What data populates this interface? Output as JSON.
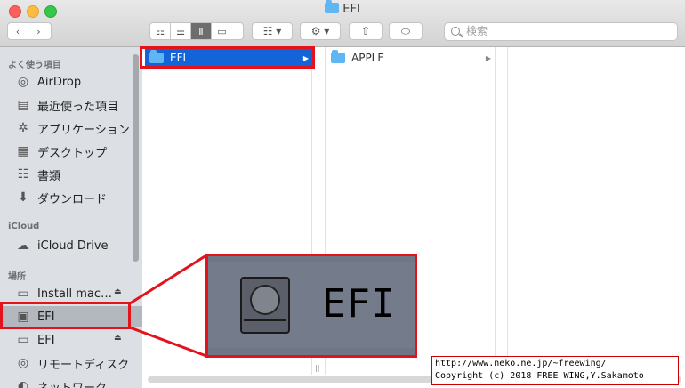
{
  "window": {
    "title": "EFI"
  },
  "toolbar": {
    "search_placeholder": "検索",
    "icons": [
      "back-icon",
      "forward-icon",
      "icon-view-icon",
      "list-view-icon",
      "column-view-icon",
      "gallery-view-icon",
      "group-icon",
      "gear-icon",
      "share-icon",
      "tag-icon"
    ]
  },
  "sidebar": {
    "favorites_header": "よく使う項目",
    "favorites": [
      {
        "label": "AirDrop",
        "icon": "airdrop-icon"
      },
      {
        "label": "最近使った項目",
        "icon": "recents-icon"
      },
      {
        "label": "アプリケーション",
        "icon": "applications-icon"
      },
      {
        "label": "デスクトップ",
        "icon": "desktop-icon"
      },
      {
        "label": "書類",
        "icon": "documents-icon"
      },
      {
        "label": "ダウンロード",
        "icon": "downloads-icon"
      }
    ],
    "icloud_header": "iCloud",
    "icloud": [
      {
        "label": "iCloud Drive",
        "icon": "cloud-icon"
      }
    ],
    "locations_header": "場所",
    "locations": [
      {
        "label": "Install mac…",
        "icon": "disk-icon",
        "eject": true
      },
      {
        "label": "EFI",
        "icon": "disk-icon",
        "eject": false,
        "selected": true
      },
      {
        "label": "EFI",
        "icon": "disk-icon",
        "eject": true
      },
      {
        "label": "リモートディスク",
        "icon": "remote-disc-icon"
      },
      {
        "label": "ネットワーク",
        "icon": "network-icon"
      }
    ]
  },
  "columns": [
    {
      "items": [
        {
          "label": "EFI",
          "selected": true
        }
      ]
    },
    {
      "items": [
        {
          "label": "APPLE",
          "selected": false
        }
      ]
    }
  ],
  "callout": {
    "zoom_label": "EFI"
  },
  "copyright": {
    "line1": "http://www.neko.ne.jp/~freewing/",
    "line2": "Copyright (c) 2018 FREE WING,Y.Sakamoto"
  },
  "colors": {
    "selection": "#1364d9",
    "callout_red": "#e3121b",
    "folder": "#5fb6f3"
  }
}
